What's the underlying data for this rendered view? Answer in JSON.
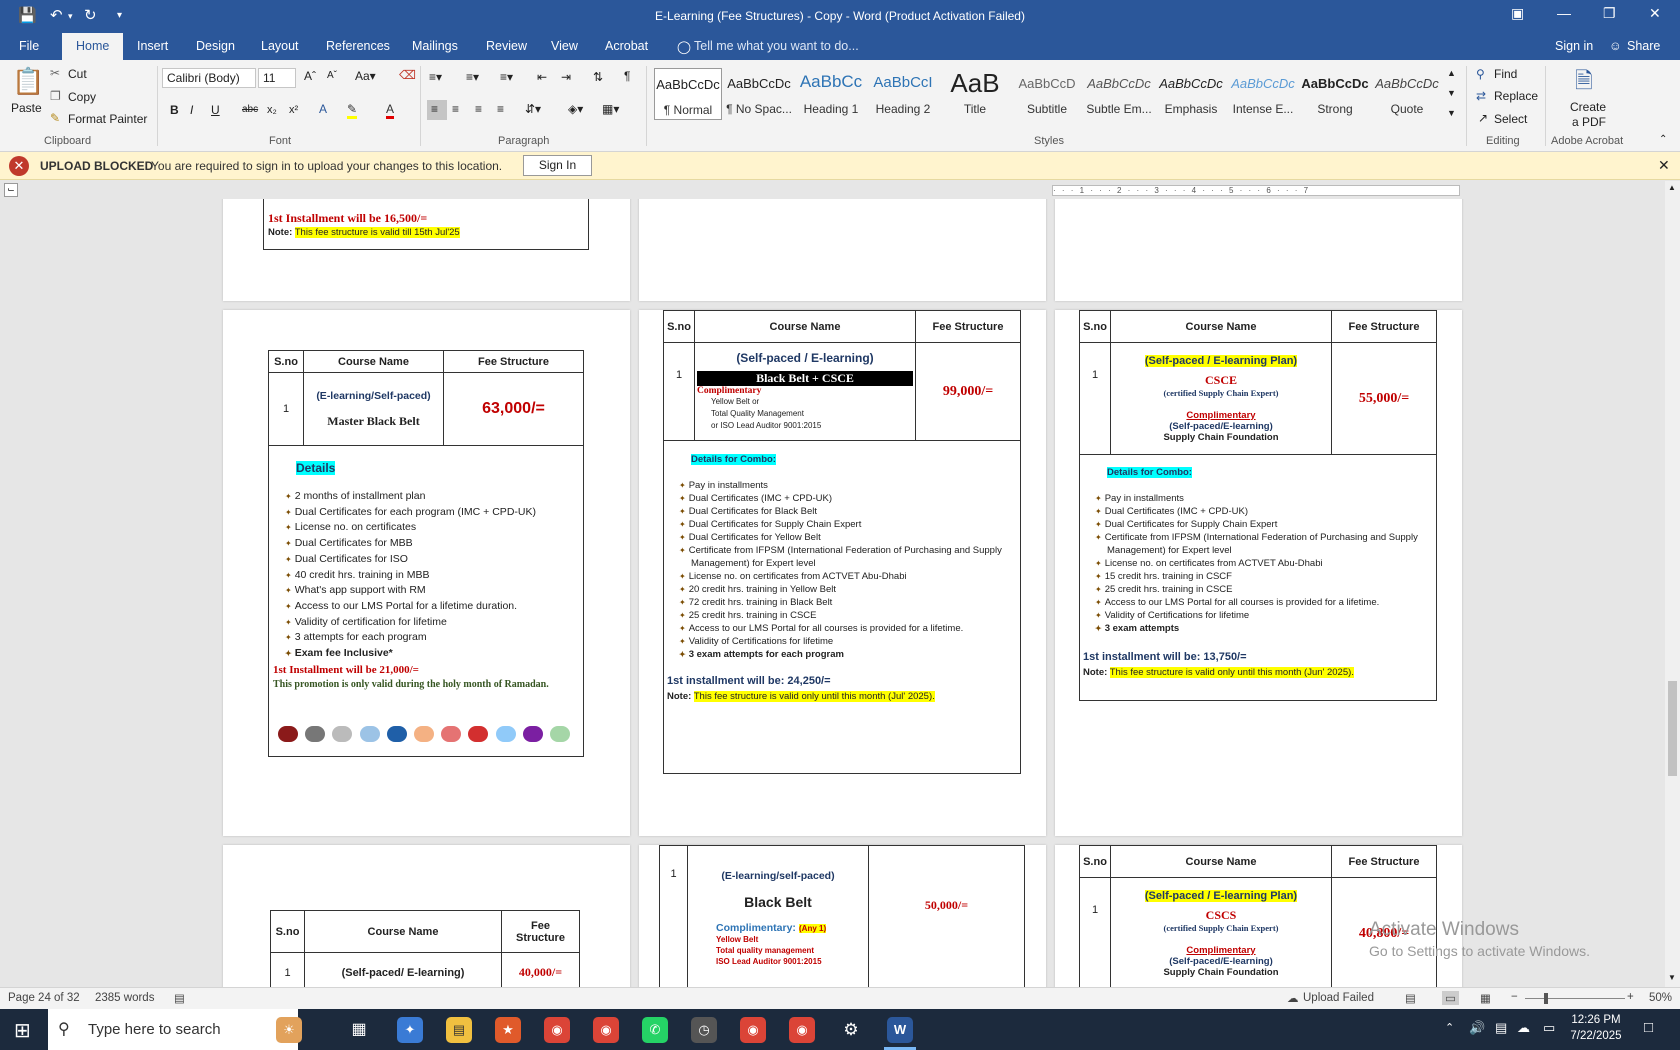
{
  "titlebar": {
    "title": "E-Learning (Fee Structures) - Copy - Word (Product Activation Failed)"
  },
  "menu": {
    "tabs": [
      "File",
      "Home",
      "Insert",
      "Design",
      "Layout",
      "References",
      "Mailings",
      "Review",
      "View",
      "Acrobat"
    ],
    "tell_me": "Tell me what you want to do...",
    "sign_in": "Sign in",
    "share": "Share"
  },
  "ribbon": {
    "clipboard": {
      "paste": "Paste",
      "cut": "Cut",
      "copy": "Copy",
      "format_painter": "Format Painter",
      "label": "Clipboard"
    },
    "font": {
      "name": "Calibri (Body)",
      "size": "11",
      "label": "Font"
    },
    "paragraph": {
      "label": "Paragraph"
    },
    "styles": {
      "label": "Styles",
      "items": [
        {
          "preview": "AaBbCcDc",
          "name": "¶ Normal"
        },
        {
          "preview": "AaBbCcDc",
          "name": "¶ No Spac..."
        },
        {
          "preview": "AaBbCc",
          "name": "Heading 1"
        },
        {
          "preview": "AaBbCcI",
          "name": "Heading 2"
        },
        {
          "preview": "AaB",
          "name": "Title"
        },
        {
          "preview": "AaBbCcD",
          "name": "Subtitle"
        },
        {
          "preview": "AaBbCcDc",
          "name": "Subtle Em..."
        },
        {
          "preview": "AaBbCcDc",
          "name": "Emphasis"
        },
        {
          "preview": "AaBbCcDc",
          "name": "Intense E..."
        },
        {
          "preview": "AaBbCcDc",
          "name": "Strong"
        },
        {
          "preview": "AaBbCcDc",
          "name": "Quote"
        }
      ]
    },
    "editing": {
      "find": "Find",
      "replace": "Replace",
      "select": "Select",
      "label": "Editing"
    },
    "acrobat": {
      "create": "Create",
      "create2": "a PDF",
      "label": "Adobe Acrobat"
    }
  },
  "banner": {
    "title": "UPLOAD BLOCKED",
    "message": "You are required to sign in to upload your changes to this location.",
    "button": "Sign In"
  },
  "doc": {
    "p1top": {
      "installment": "1st Installment  will be 16,500/=",
      "note_label": "Note:",
      "note": "This fee structure is valid till 15th Jul'25"
    },
    "headers": {
      "sno": "S.no",
      "course": "Course Name",
      "fee": "Fee Structure"
    },
    "p4": {
      "sno": "1",
      "plan": "(E-learning/Self-paced)",
      "course": "Master Black Belt",
      "fee": "63,000/=",
      "details": "Details",
      "items": [
        "2 months of installment plan",
        "Dual Certificates for each program (IMC + CPD-UK)",
        "License no. on certificates",
        "Dual Certificates for MBB",
        "Dual Certificates for ISO",
        "40 credit hrs. training in MBB",
        "What's app support with RM",
        "Access to our LMS Portal for a lifetime duration.",
        "Validity of certification for lifetime",
        "3 attempts for each program",
        "Exam fee Inclusive*"
      ],
      "installment": "1st Installment will be 21,000/=",
      "promo": "This promotion is only valid during the holy month of Ramadan."
    },
    "p5": {
      "sno": "1",
      "plan": "(Self-paced / E-learning)",
      "course": "Black Belt + CSCE",
      "fee": "99,000/=",
      "compl": "Complimentary",
      "compl_items": [
        "Yellow Belt or",
        "Total Quality Management",
        "or ISO Lead Auditor 9001:2015"
      ],
      "details": "Details for Combo:",
      "items": [
        "Pay in installments",
        "Dual Certificates (IMC + CPD-UK)",
        "Dual Certificates for Black Belt",
        "Dual Certificates for Supply Chain Expert",
        "Dual Certificates for Yellow Belt",
        "Certificate from IFPSM (International Federation of Purchasing and Supply",
        "Management) for Expert level",
        "License no. on certificates from ACTVET Abu-Dhabi",
        "20 credit hrs. training in Yellow Belt",
        "72 credit hrs. training in Black Belt",
        "25 credit hrs. training in CSCE",
        "Access to our LMS Portal for all courses is provided for a lifetime.",
        "Validity of Certifications for lifetime",
        "3 exam attempts for each program"
      ],
      "installment": "1st installment will be: 24,250/=",
      "note_label": "Note:",
      "note": "This fee structure is valid only until this month (Jul' 2025)."
    },
    "p6": {
      "sno": "1",
      "plan": "(Self-paced / E-learning Plan)",
      "course": "CSCE",
      "course_sub": "(certified Supply Chain Expert)",
      "fee": "55,000/=",
      "compl": "Complimentary",
      "compl_plan": "(Self-paced/E-learning)",
      "compl_course": "Supply Chain Foundation",
      "details": "Details for Combo:",
      "items": [
        "Pay in installments",
        "Dual Certificates (IMC + CPD-UK)",
        "Dual Certificates for Supply Chain Expert",
        "Certificate from IFPSM (International Federation of Purchasing and Supply",
        "Management) for Expert level",
        "License no. on certificates from ACTVET Abu-Dhabi",
        "15 credit hrs. training in CSCF",
        "25 credit hrs. training in CSCE",
        "Access to our LMS Portal for all courses is provided for a lifetime.",
        "Validity of Certifications for lifetime",
        "3 exam attempts"
      ],
      "installment": "1st installment will be: 13,750/=",
      "note_label": "Note:",
      "note": "This fee structure is valid only until this month (Jun' 2025)."
    },
    "p7": {
      "sno_h": "S.no",
      "course_h": "Course Name",
      "fee_h1": "Fee",
      "fee_h2": "Structure",
      "sno": "1",
      "plan": "(Self-paced/ E-learning)",
      "fee": "40,000/="
    },
    "p8": {
      "sno": "1",
      "plan": "(E-learning/self-paced)",
      "course": "Black Belt",
      "fee": "50,000/=",
      "compl": "Complimentary:",
      "any": "(Any 1)",
      "items": [
        "Yellow Belt",
        "Total quality management",
        "ISO Lead Auditor 9001:2015"
      ]
    },
    "p9": {
      "sno": "1",
      "plan": "(Self-paced / E-learning Plan)",
      "course": "CSCS",
      "course_sub": "(certified Supply Chain Expert)",
      "fee": "40,800/=",
      "compl": "Complimentary",
      "compl_plan": "(Self-paced/E-learning)",
      "compl_course": "Supply Chain Foundation"
    }
  },
  "watermark": {
    "line1": "Activate Windows",
    "line2": "Go to Settings to activate Windows."
  },
  "status": {
    "page": "Page 24 of 32",
    "words": "2385 words",
    "upload": "Upload Failed",
    "zoom": "50%"
  },
  "taskbar": {
    "search": "Type here to search",
    "time": "12:26 PM",
    "date": "7/22/2025"
  }
}
